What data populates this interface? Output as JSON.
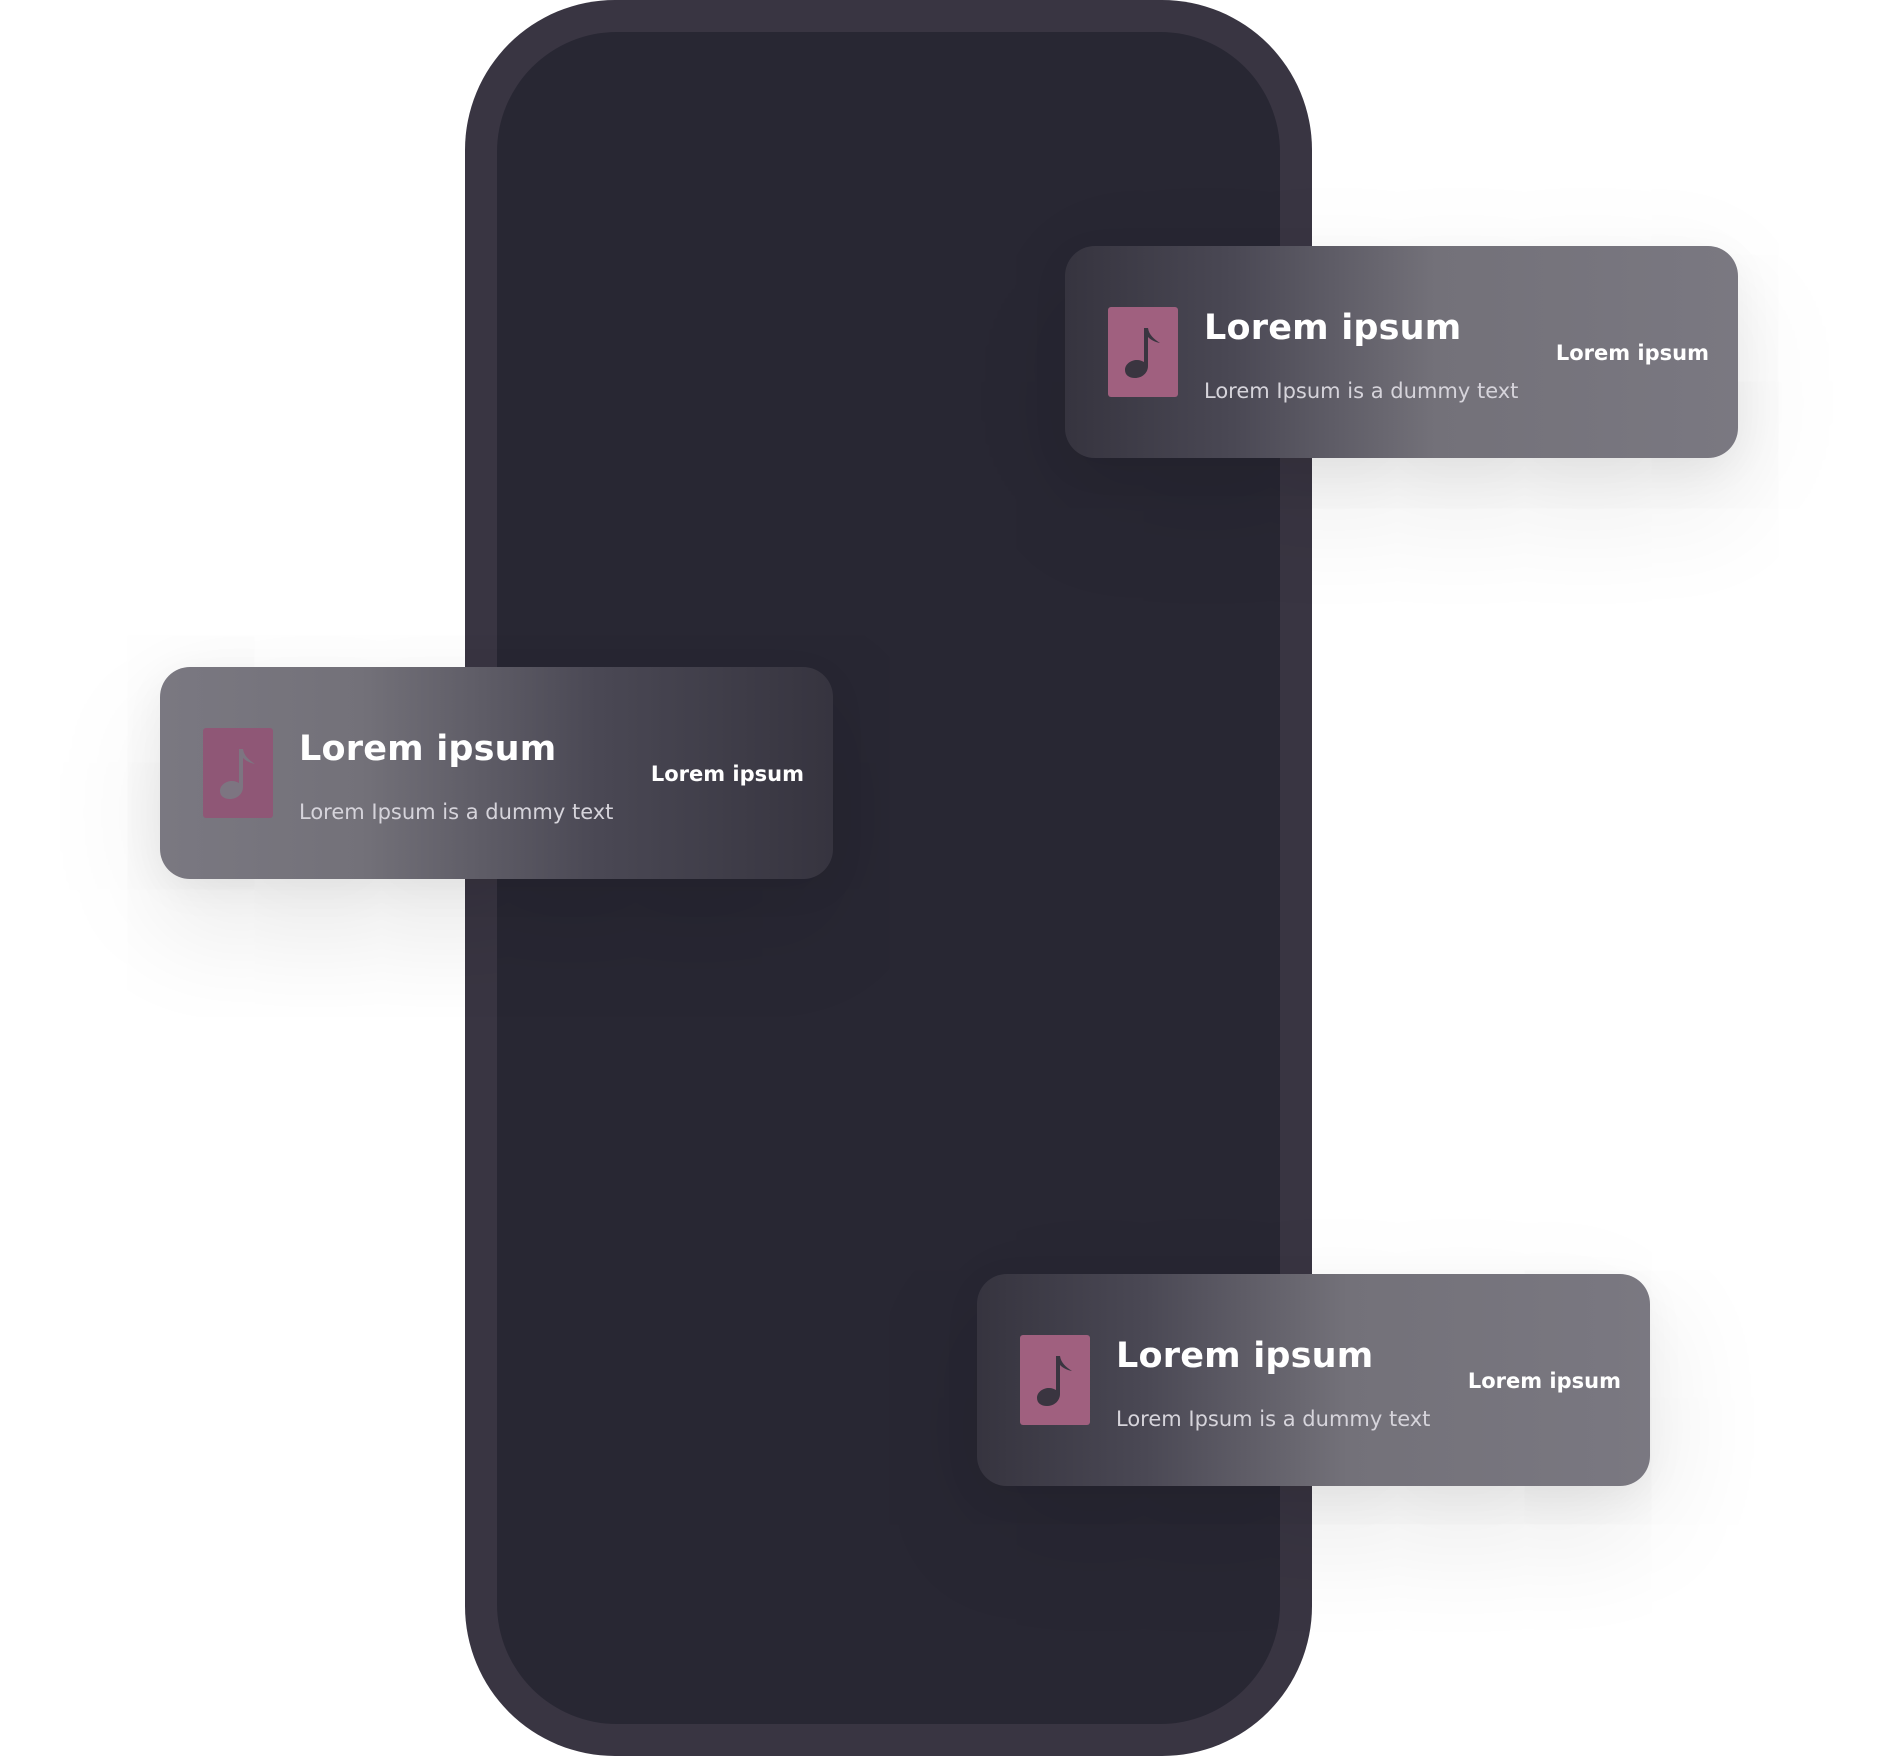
{
  "colors": {
    "phone_bezel": "#393542",
    "phone_screen": "#282733",
    "icon_tile": "#a0607f",
    "icon_glyph": "#3a3540",
    "card_dark": "#36343f",
    "card_light": "#7a7881"
  },
  "notifications": [
    {
      "icon": "music-note-icon",
      "title": "Lorem ipsum",
      "description": "Lorem Ipsum is a dummy text",
      "action": "Lorem ipsum"
    },
    {
      "icon": "music-note-icon",
      "title": "Lorem ipsum",
      "description": "Lorem Ipsum is a dummy text",
      "action": "Lorem ipsum"
    },
    {
      "icon": "music-note-icon",
      "title": "Lorem ipsum",
      "description": "Lorem Ipsum is a dummy text",
      "action": "Lorem ipsum"
    }
  ]
}
